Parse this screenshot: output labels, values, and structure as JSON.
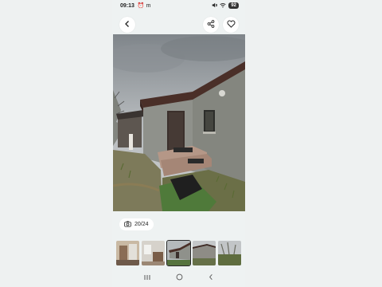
{
  "status_bar": {
    "time": "09:13",
    "left_icons": [
      "alarm-icon",
      "m"
    ],
    "battery": "92"
  },
  "header": {
    "back_icon": "chevron-left-icon",
    "share_icon": "share-icon",
    "favorite_icon": "heart-outline-icon"
  },
  "gallery": {
    "counter_text": "20/24",
    "counter_icon": "camera-icon",
    "thumbnails": [
      {
        "label": "interior-kitchen"
      },
      {
        "label": "interior-room"
      },
      {
        "label": "house-entrance",
        "active": true
      },
      {
        "label": "house-side"
      },
      {
        "label": "yard"
      }
    ]
  },
  "navbar": {
    "recent_icon": "recent-apps-icon",
    "home_icon": "home-circle-icon",
    "back_icon": "back-chevron-icon"
  },
  "colors": {
    "background": "#eef1f1",
    "photo_sky": "#9ea3a8",
    "wall": "#8f918b",
    "grass": "#4f7a3a"
  }
}
